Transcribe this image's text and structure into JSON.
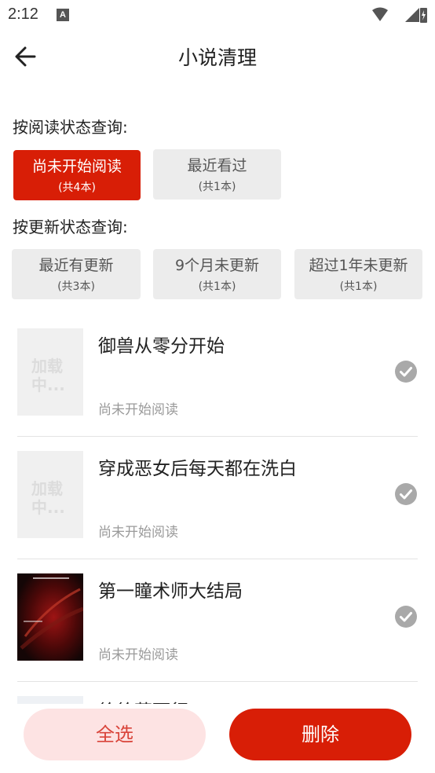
{
  "status_bar": {
    "time": "2:12",
    "notification_icon": "A"
  },
  "header": {
    "title": "小说清理",
    "back_icon": "arrow-left"
  },
  "read_filter": {
    "label": "按阅读状态查询:",
    "chips": [
      {
        "label": "尚未开始阅读",
        "count": "(共4本)",
        "active": true
      },
      {
        "label": "最近看过",
        "count": "(共1本)",
        "active": false
      }
    ]
  },
  "update_filter": {
    "label": "按更新状态查询:",
    "chips": [
      {
        "label": "最近有更新",
        "count": "(共3本)",
        "active": false
      },
      {
        "label": "9个月未更新",
        "count": "(共1本)",
        "active": false
      },
      {
        "label": "超过1年未更新",
        "count": "(共1本)",
        "active": false
      }
    ]
  },
  "books": [
    {
      "title": "御兽从零分开始",
      "status": "尚未开始阅读",
      "cover": "placeholder",
      "placeholder_text": "加载中...",
      "checked": true
    },
    {
      "title": "穿成恶女后每天都在洗白",
      "status": "尚未开始阅读",
      "cover": "placeholder",
      "placeholder_text": "加载中...",
      "checked": true
    },
    {
      "title": "第一瞳术师大结局",
      "status": "尚未开始阅读",
      "cover": "image",
      "checked": true
    }
  ],
  "partial_book": {
    "title": "徐徐董而行"
  },
  "actions": {
    "select_all": "全选",
    "delete": "删除"
  },
  "colors": {
    "accent": "#d81e06",
    "chip_bg": "#ececec",
    "check": "#a9a9a9",
    "select_bg": "#fde3e3"
  }
}
